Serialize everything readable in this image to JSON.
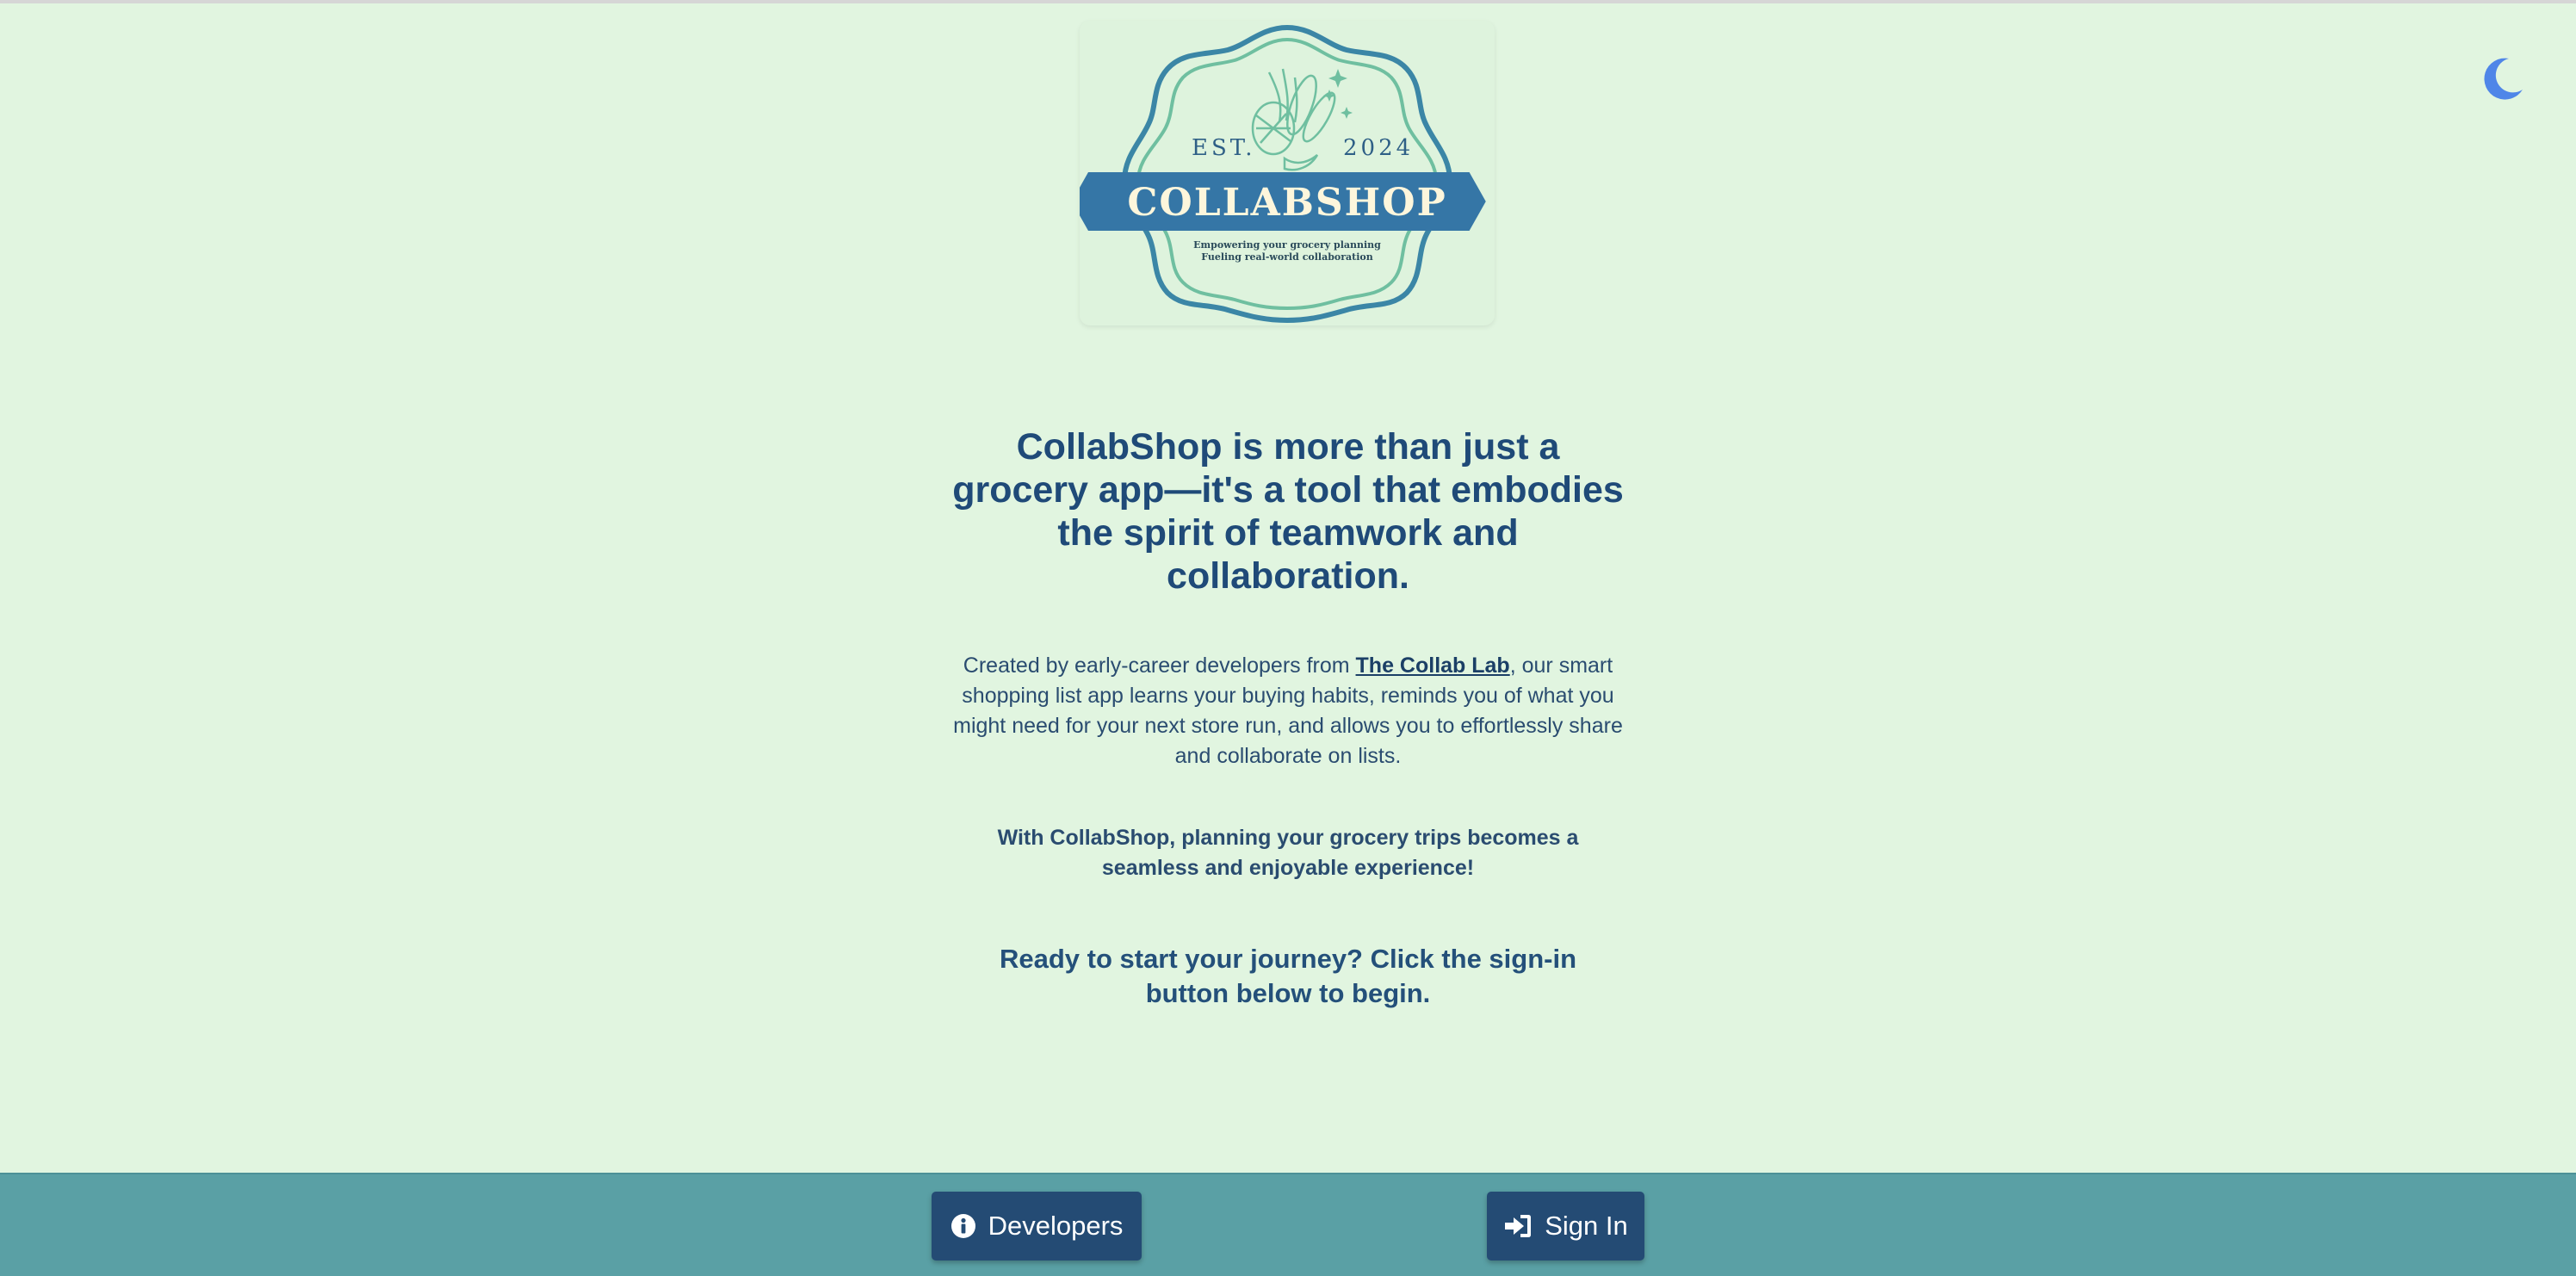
{
  "theme_toggle": {
    "icon": "moon-icon"
  },
  "logo": {
    "est": "EST.",
    "year": "2024",
    "brand": "COLLABSHOP",
    "tagline_1": "Empowering your grocery planning",
    "tagline_2": "Fueling real-world collaboration"
  },
  "hero": {
    "headline": "CollabShop is more than just a grocery app—it's a tool that embodies the spirit of teamwork and collaboration.",
    "para1_before": "Created by early-career developers from ",
    "para1_link": "The Collab Lab",
    "para1_after": ", our smart shopping list app learns your buying habits, reminds you of what you might need for your next store run, and allows you to effortlessly share and collaborate on lists.",
    "para2": "With CollabShop, planning your grocery trips becomes a seamless and enjoyable experience!",
    "para3": "Ready to start your journey? Click the sign-in button below to begin."
  },
  "footer": {
    "developers_label": "Developers",
    "developers_icon": "info-circle-icon",
    "signin_label": "Sign In",
    "signin_icon": "sign-in-icon"
  },
  "colors": {
    "background": "#e1f5e0",
    "text": "#244b74",
    "footer": "#5aa0a5",
    "button": "#244b74",
    "toggle": "#4f86e8"
  }
}
